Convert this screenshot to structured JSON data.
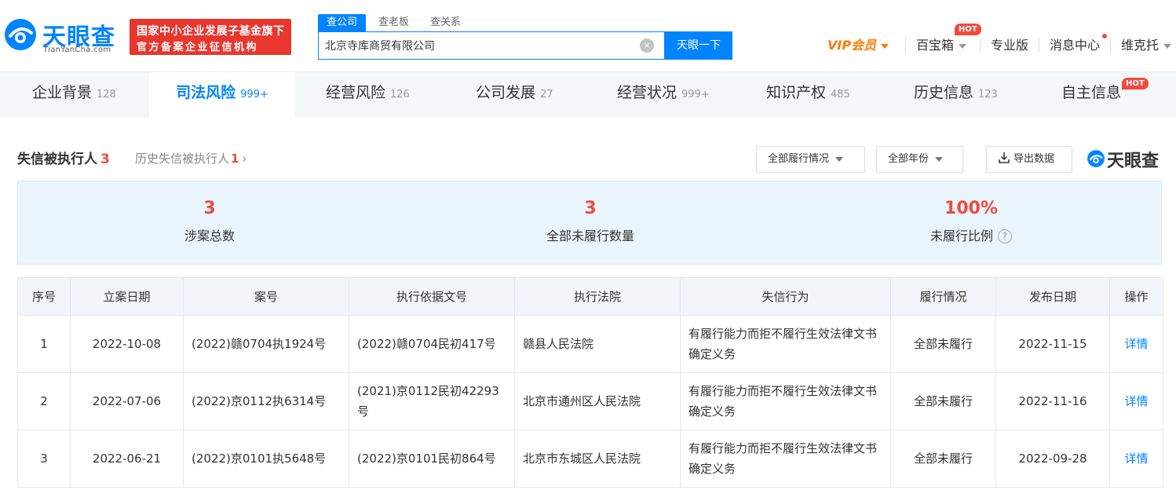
{
  "brand": {
    "name_cn": "天眼查",
    "name_en": "TianYanCha.com",
    "badge_line1": "国家中小企业发展子基金旗下",
    "badge_line2": "官方备案企业征信机构",
    "color": "#0084ff"
  },
  "search": {
    "tabs": [
      "查公司",
      "查老板",
      "查关系"
    ],
    "active_tab": "查公司",
    "value": "北京寺库商贸有限公司",
    "button_label": "天眼一下"
  },
  "nav": {
    "vip_label": "VIP会员",
    "baibaoxiang_label": "百宝箱",
    "hot_label": "HOT",
    "pro_label": "专业版",
    "messages_label": "消息中心",
    "user_label": "维克托"
  },
  "categories": [
    {
      "label": "企业背景",
      "count": "128"
    },
    {
      "label": "司法风险",
      "count": "999+"
    },
    {
      "label": "经营风险",
      "count": "126"
    },
    {
      "label": "公司发展",
      "count": "27"
    },
    {
      "label": "经营状况",
      "count": "999+"
    },
    {
      "label": "知识产权",
      "count": "485"
    },
    {
      "label": "历史信息",
      "count": "123"
    },
    {
      "label": "自主信息",
      "count": ""
    }
  ],
  "active_category": "司法风险",
  "section": {
    "title": "失信被执行人",
    "title_count": "3",
    "history_label": "历史失信被执行人",
    "history_count": "1",
    "chevron": "›",
    "filter_status": "全部履行情况",
    "filter_year": "全部年份",
    "export_label": "导出数据",
    "brand_label": "天眼查"
  },
  "stats": [
    {
      "value": "3",
      "label": "涉案总数"
    },
    {
      "value": "3",
      "label": "全部未履行数量"
    },
    {
      "value": "100%",
      "label": "未履行比例",
      "help": "?"
    }
  ],
  "table": {
    "headers": [
      "序号",
      "立案日期",
      "案号",
      "执行依据文号",
      "执行法院",
      "失信行为",
      "履行情况",
      "发布日期",
      "操作"
    ],
    "rows": [
      {
        "no": "1",
        "filing_date": "2022-10-08",
        "case_no": "(2022)赣0704执1924号",
        "basis_doc": "(2022)赣0704民初417号",
        "court": "赣县人民法院",
        "behavior": "有履行能力而拒不履行生效法律文书确定义务",
        "status": "全部未履行",
        "publish_date": "2022-11-15",
        "action": "详情"
      },
      {
        "no": "2",
        "filing_date": "2022-07-06",
        "case_no": "(2022)京0112执6314号",
        "basis_doc": "(2021)京0112民初42293号",
        "court": "北京市通州区人民法院",
        "behavior": "有履行能力而拒不履行生效法律文书确定义务",
        "status": "全部未履行",
        "publish_date": "2022-11-16",
        "action": "详情"
      },
      {
        "no": "3",
        "filing_date": "2022-06-21",
        "case_no": "(2022)京0101执5648号",
        "basis_doc": "(2022)京0101民初864号",
        "court": "北京市东城区人民法院",
        "behavior": "有履行能力而拒不履行生效法律文书确定义务",
        "status": "全部未履行",
        "publish_date": "2022-09-28",
        "action": "详情"
      }
    ]
  },
  "colors": {
    "accent": "#0084ff",
    "alert": "#f04a3e",
    "vip": "#ff7a00",
    "badge": "#e8372d"
  }
}
